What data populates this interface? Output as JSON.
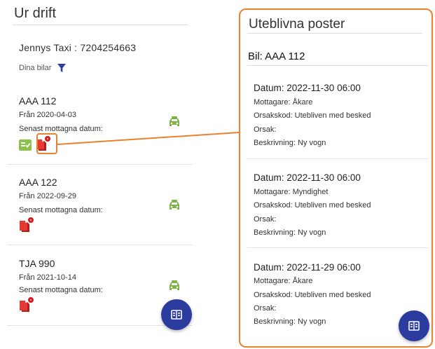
{
  "left": {
    "title": "Ur drift",
    "company": "Jennys Taxi : 7204254663",
    "filter_label": "Dina bilar",
    "cars": [
      {
        "name": "AAA 112",
        "from": "Från 2020-04-03",
        "recv_label": "Senast mottagna datum:"
      },
      {
        "name": "AAA 122",
        "from": "Från 2022-09-29",
        "recv_label": "Senast mottagna datum:"
      },
      {
        "name": "TJA 990",
        "from": "Från 2021-10-14",
        "recv_label": "Senast mottagna datum:"
      }
    ]
  },
  "right": {
    "title": "Uteblivna poster",
    "bil": "Bil: AAA 112",
    "posts": [
      {
        "date": "Datum: 2022-11-30 06:00",
        "recipient": "Mottagare: Åkare",
        "code": "Orsakskod: Utebliven med besked",
        "reason": "Orsak:",
        "desc": "Beskrivning: Ny vogn"
      },
      {
        "date": "Datum: 2022-11-30 06:00",
        "recipient": "Mottagare: Myndighet",
        "code": "Orsakskod: Utebliven med besked",
        "reason": "Orsak:",
        "desc": "Beskrivning: Ny vogn"
      },
      {
        "date": "Datum: 2022-11-29 06:00",
        "recipient": "Mottagare: Åkare",
        "code": "Orsakskod: Utebliven med besked",
        "reason": "Orsak:",
        "desc": "Beskrivning: Ny vogn"
      }
    ]
  },
  "icons": {
    "filter": "filter-funnel-icon",
    "taxi": "taxi-car-icon",
    "missing_doc": "missing-document-icon",
    "received_card": "received-card-icon",
    "fab": "building-list-icon"
  },
  "colors": {
    "accent_orange": "#e8822e",
    "fab_blue": "#2b3b9e",
    "taxi_green": "#7cb342",
    "alert_red": "#d9191e"
  }
}
